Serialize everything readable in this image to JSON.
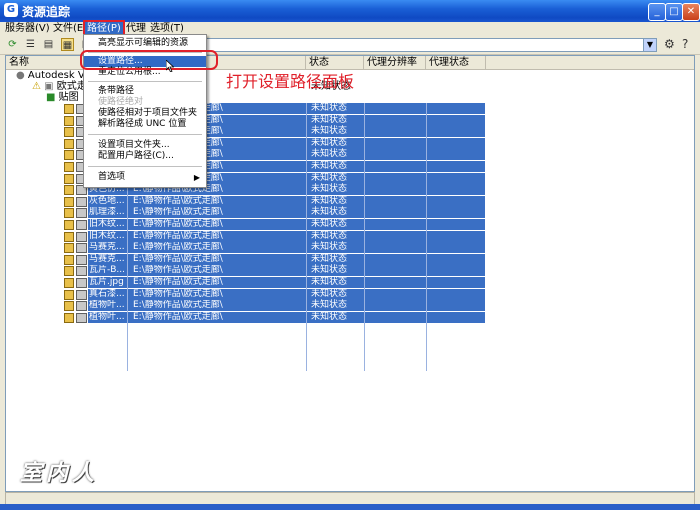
{
  "window": {
    "title": "资源追踪",
    "app_icon": "G"
  },
  "menubar": [
    {
      "label": "服务器(V)"
    },
    {
      "label": "文件(E)"
    },
    {
      "label": "路径(P)"
    },
    {
      "label": "代理"
    },
    {
      "label": "选项(T)"
    }
  ],
  "toolbar": {
    "combo_value": "",
    "icons": [
      "refresh-icon",
      "list-icon",
      "details-icon",
      "thumbnails-icon",
      "filter-icon",
      "dropdown-icon",
      "settings-icon",
      "help-icon"
    ]
  },
  "columns": [
    "名称",
    "状态",
    "代理分辨率",
    "代理状态"
  ],
  "tree": {
    "root": "Autodesk Vault",
    "project": "欧式走廊",
    "project_status": "未知状态",
    "folder": "贴图"
  },
  "rows": [
    {
      "name": "",
      "path": "E:\\静物作品\\欧式走廊\\",
      "status": "未知状态"
    },
    {
      "name": "",
      "path": "E:\\静物作品\\欧式走廊\\",
      "status": "未知状态"
    },
    {
      "name": "",
      "path": "E:\\静物作品\\欧式走廊\\",
      "status": "未知状态"
    },
    {
      "name": "",
      "path": "E:\\静物作品\\欧式走廊\\",
      "status": "未知状态"
    },
    {
      "name": "",
      "path": "E:\\静物作品\\欧式走廊\\",
      "status": "未知状态"
    },
    {
      "name": "",
      "path": "E:\\静物作品\\欧式走廊\\",
      "status": "未知状态"
    },
    {
      "name": "",
      "path": "E:\\静物作品\\欧式走廊\\",
      "status": "未知状态"
    },
    {
      "name": "黄色仿...",
      "path": "E:\\静物作品\\欧式走廊\\",
      "status": "未知状态"
    },
    {
      "name": "灰色地...",
      "path": "E:\\静物作品\\欧式走廊\\",
      "status": "未知状态"
    },
    {
      "name": "肌理漆...",
      "path": "E:\\静物作品\\欧式走廊\\",
      "status": "未知状态"
    },
    {
      "name": "旧木纹...",
      "path": "E:\\静物作品\\欧式走廊\\",
      "status": "未知状态"
    },
    {
      "name": "旧木纹...",
      "path": "E:\\静物作品\\欧式走廊\\",
      "status": "未知状态"
    },
    {
      "name": "马赛克...",
      "path": "E:\\静物作品\\欧式走廊\\",
      "status": "未知状态"
    },
    {
      "name": "马赛克...",
      "path": "E:\\静物作品\\欧式走廊\\",
      "status": "未知状态"
    },
    {
      "name": "瓦片-B...",
      "path": "E:\\静物作品\\欧式走廊\\",
      "status": "未知状态"
    },
    {
      "name": "瓦片.jpg",
      "path": "E:\\静物作品\\欧式走廊\\",
      "status": "未知状态"
    },
    {
      "name": "真石漆...",
      "path": "E:\\静物作品\\欧式走廊\\",
      "status": "未知状态"
    },
    {
      "name": "植物叶...",
      "path": "E:\\静物作品\\欧式走廊\\",
      "status": "未知状态"
    },
    {
      "name": "植物叶...",
      "path": "E:\\静物作品\\欧式走廊\\",
      "status": "未知状态"
    }
  ],
  "path_menu": {
    "items": [
      {
        "label": "高亮显示可编辑的资源",
        "state": "normal"
      },
      {
        "label": "设置路径...",
        "state": "highlighted"
      },
      {
        "label": "重定位公用根...",
        "state": "normal"
      },
      {
        "label": "条带路径",
        "state": "normal"
      },
      {
        "label": "使路径绝对",
        "state": "disabled"
      },
      {
        "label": "使路径相对于项目文件夹",
        "state": "normal"
      },
      {
        "label": "解析路径成 UNC 位置",
        "state": "normal"
      },
      {
        "label": "设置项目文件夹...",
        "state": "normal"
      },
      {
        "label": "配置用户路径(C)...",
        "state": "normal"
      },
      {
        "label": "首选项",
        "state": "submenu"
      }
    ]
  },
  "annotation": "打开设置路径面板",
  "watermark": "室内人",
  "colors": {
    "selection": "#3a6fc4",
    "highlight_border": "#e0202a",
    "titlebar": "#1a5fd6"
  }
}
